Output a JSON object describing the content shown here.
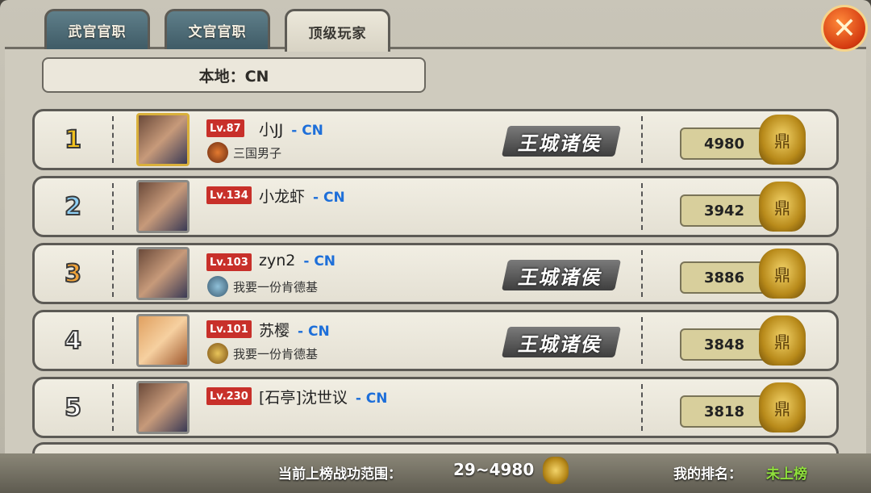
{
  "tabs": [
    {
      "label": "武官官职"
    },
    {
      "label": "文官官职"
    },
    {
      "label": "顶级玩家"
    }
  ],
  "region": "本地：CN",
  "close_icon": "close-x-icon",
  "rows": [
    {
      "rank": "1",
      "level": "Lv.87",
      "name": "小JJ",
      "server": "- CN",
      "guild": "三国男子",
      "title": "王城诸侯",
      "score": "4980",
      "rank_color": "#f2c21e"
    },
    {
      "rank": "2",
      "level": "Lv.134",
      "name": "小龙虾",
      "server": "- CN",
      "guild": "",
      "title": "",
      "score": "3942",
      "rank_color": "#8fd0f5"
    },
    {
      "rank": "3",
      "level": "Lv.103",
      "name": "zyn2",
      "server": "- CN",
      "guild": "我要一份肯德基",
      "title": "王城诸侯",
      "score": "3886",
      "rank_color": "#f2a43a"
    },
    {
      "rank": "4",
      "level": "Lv.101",
      "name": "苏樱",
      "server": "- CN",
      "guild": "我要一份肯德基",
      "title": "王城诸侯",
      "score": "3848",
      "rank_color": "#ffffff"
    },
    {
      "rank": "5",
      "level": "Lv.230",
      "name": "[石亭]沈世议",
      "server": "- CN",
      "guild": "",
      "title": "",
      "score": "3818",
      "rank_color": "#ffffff"
    }
  ],
  "footer": {
    "range_label": "当前上榜战功范围：",
    "range_value": "29~4980",
    "my_rank_label": "我的排名：",
    "my_rank_value": "未上榜"
  }
}
